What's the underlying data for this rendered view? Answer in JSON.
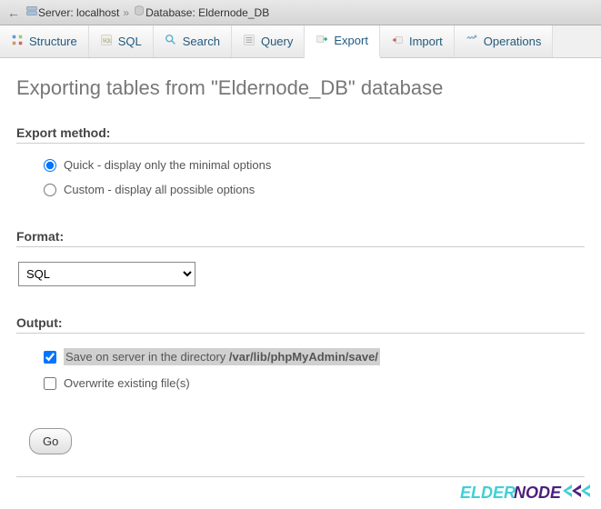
{
  "breadcrumb": {
    "server_label": "Server:",
    "server_name": "localhost",
    "database_label": "Database:",
    "database_name": "Eldernode_DB"
  },
  "tabs": {
    "structure": "Structure",
    "sql": "SQL",
    "search": "Search",
    "query": "Query",
    "export": "Export",
    "import": "Import",
    "operations": "Operations"
  },
  "page": {
    "title_prefix": "Exporting tables from \"",
    "title_db": "Eldernode_DB",
    "title_suffix": "\" database"
  },
  "export_method": {
    "heading": "Export method:",
    "quick": "Quick - display only the minimal options",
    "custom": "Custom - display all possible options"
  },
  "format": {
    "heading": "Format:",
    "options": [
      "SQL"
    ],
    "selected": "SQL"
  },
  "output": {
    "heading": "Output:",
    "save_server_prefix": "Save on server in the directory ",
    "save_server_path": "/var/lib/phpMyAdmin/save/",
    "overwrite": "Overwrite existing file(s)"
  },
  "go_button": "Go",
  "watermark": {
    "part1": "ELDER",
    "part2": "NODE"
  }
}
